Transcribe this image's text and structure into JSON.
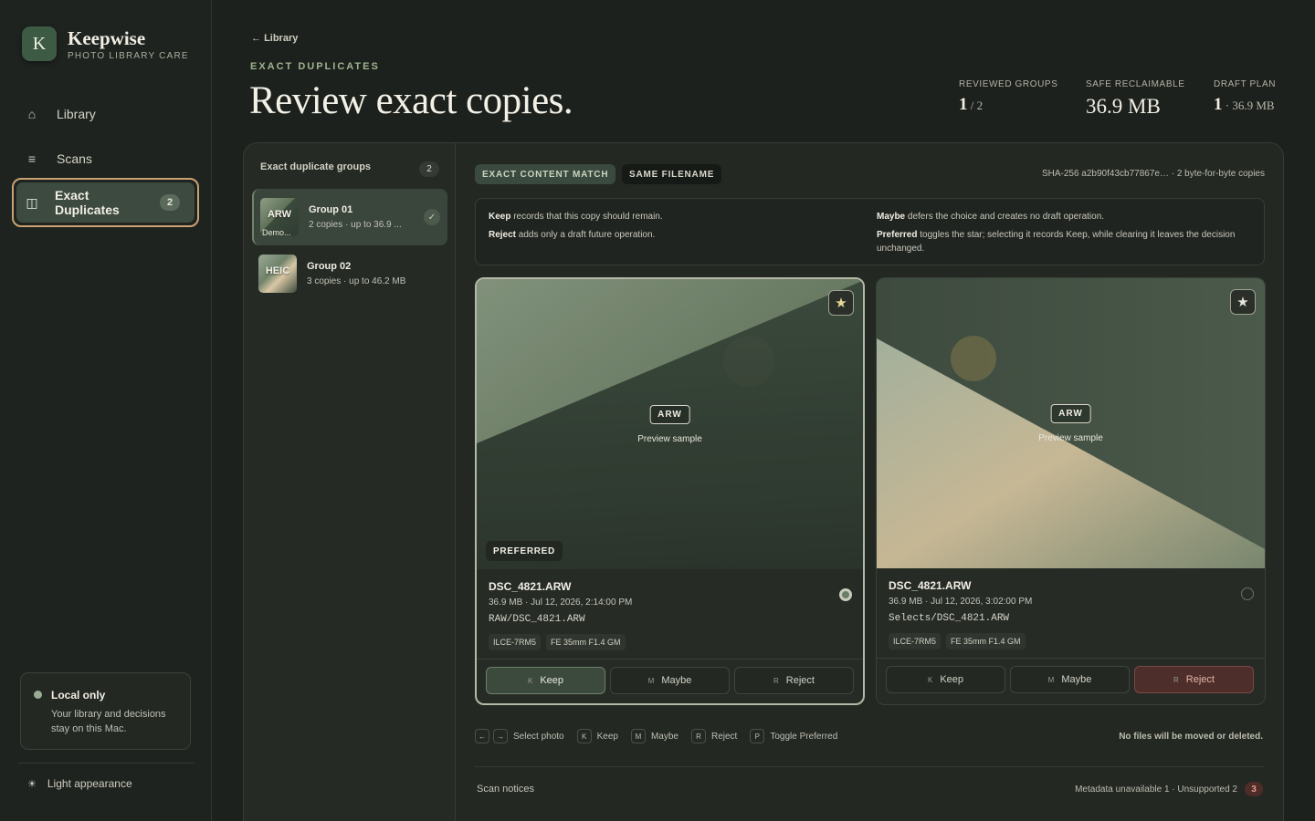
{
  "brand": {
    "logo_letter": "K",
    "name": "Keepwise",
    "tagline": "PHOTO LIBRARY CARE"
  },
  "nav": {
    "library": "Library",
    "scans": "Scans",
    "exact_duplicates": "Exact Duplicates",
    "exact_duplicates_count": "2"
  },
  "local_card": {
    "title": "Local only",
    "text": "Your library and decisions stay on this Mac."
  },
  "appearance_label": "Light appearance",
  "header": {
    "back_link": "Library",
    "eyebrow": "EXACT DUPLICATES",
    "title": "Review exact copies.",
    "stats": [
      {
        "label": "REVIEWED GROUPS",
        "value": "1",
        "suffix": " / 2"
      },
      {
        "label": "SAFE RECLAIMABLE",
        "value": "36.9 MB",
        "suffix": ""
      },
      {
        "label": "DRAFT PLAN",
        "value": "1",
        "suffix": " · 36.9 MB"
      }
    ]
  },
  "groups": {
    "heading": "Exact duplicate groups",
    "count": "2",
    "items": [
      {
        "format": "ARW",
        "thumb_sub": "Demo...",
        "title": "Group 01",
        "sub": "2 copies · up to 36.9 ...",
        "reviewed": true
      },
      {
        "format": "HEIC",
        "thumb_sub": "",
        "title": "Group 02",
        "sub": "3 copies · up to 46.2 MB",
        "reviewed": false
      }
    ]
  },
  "detail": {
    "chips": [
      "EXACT CONTENT MATCH",
      "SAME FILENAME"
    ],
    "hash": "SHA-256 a2b90f43cb77867e… · 2 byte-for-byte copies",
    "help": {
      "keep_term": "Keep",
      "keep_text": " records that this copy should remain.",
      "reject_term": "Reject",
      "reject_text": " adds only a draft future operation.",
      "maybe_term": "Maybe",
      "maybe_text": " defers the choice and creates no draft operation.",
      "preferred_term": "Preferred",
      "preferred_text": " toggles the star; selecting it records Keep, while clearing it leaves the decision unchanged."
    },
    "cards": [
      {
        "format": "ARW",
        "preview_label": "Preview sample",
        "preferred_badge": "PREFERRED",
        "filename": "DSC_4821.ARW",
        "meta": "36.9 MB · Jul 12, 2026, 2:14:00 PM",
        "path": "RAW/DSC_4821.ARW",
        "tags": [
          "ILCE-7RM5",
          "FE 35mm F1.4 GM"
        ],
        "selected": true,
        "decision": "Keep"
      },
      {
        "format": "ARW",
        "preview_label": "Preview sample",
        "preferred_badge": "",
        "filename": "DSC_4821.ARW",
        "meta": "36.9 MB · Jul 12, 2026, 3:02:00 PM",
        "path": "Selects/DSC_4821.ARW",
        "tags": [
          "ILCE-7RM5",
          "FE 35mm F1.4 GM"
        ],
        "selected": false,
        "decision": "Reject"
      }
    ],
    "actions": {
      "keep": "Keep",
      "keep_key": "K",
      "maybe": "Maybe",
      "maybe_key": "M",
      "reject": "Reject",
      "reject_key": "R"
    },
    "shortcuts": {
      "left_key": "←",
      "right_key": "→",
      "select": "Select photo",
      "k_key": "K",
      "keep": "Keep",
      "m_key": "M",
      "maybe": "Maybe",
      "r_key": "R",
      "reject": "Reject",
      "p_key": "P",
      "toggle": "Toggle Preferred"
    },
    "no_files_note": "No files will be moved or deleted.",
    "notices": {
      "label": "Scan notices",
      "summary": "Metadata unavailable 1 · Unsupported 2",
      "count": "3"
    }
  },
  "colors": {
    "accent_gold": "#c9a273",
    "sage": "#3c5a44",
    "reject": "#4d2e2a"
  },
  "icons": {
    "library": "house-icon",
    "scans": "list-icon",
    "duplicates": "columns-icon",
    "star": "star-icon",
    "appearance": "sun-icon"
  }
}
